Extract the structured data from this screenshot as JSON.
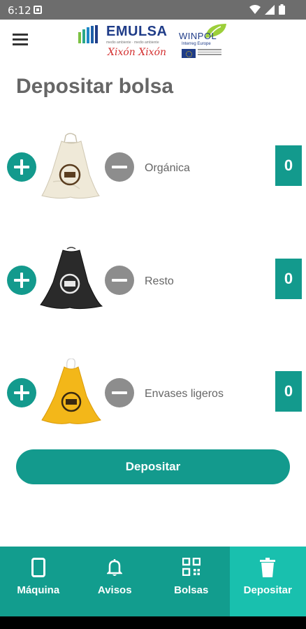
{
  "status_bar": {
    "time": "6:12"
  },
  "header": {
    "emulsa_name": "EMULSA",
    "emulsa_tagline": "medio ambiente · medio ambiente",
    "emulsa_city": "Xixón Xixón",
    "winpol_name": "WINPOL",
    "winpol_sub": "Interreg Europe"
  },
  "page": {
    "title": "Depositar bolsa"
  },
  "bags": [
    {
      "label": "Orgánica",
      "count": "0",
      "color": "#efe9d8",
      "emblem_color": "#5a3d1f"
    },
    {
      "label": "Resto",
      "count": "0",
      "color": "#2a2a2a",
      "emblem_color": "#e8e8e8"
    },
    {
      "label": "Envases ligeros",
      "count": "0",
      "color": "#f3b719",
      "emblem_color": "#3a2a10"
    }
  ],
  "actions": {
    "deposit_label": "Depositar"
  },
  "nav": {
    "items": [
      {
        "label": "Máquina",
        "icon": "phone-icon"
      },
      {
        "label": "Avisos",
        "icon": "bell-icon"
      },
      {
        "label": "Bolsas",
        "icon": "qr-code-icon"
      },
      {
        "label": "Depositar",
        "icon": "trash-icon"
      }
    ],
    "active_index": 3
  },
  "colors": {
    "primary": "#139a8d",
    "nav_bg": "#129d8e",
    "nav_active": "#19c0ae",
    "minus": "#8d8d8d"
  }
}
